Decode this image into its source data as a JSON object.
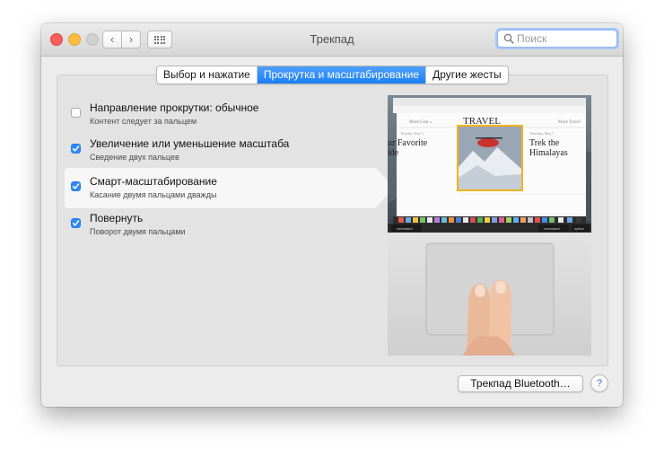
{
  "window": {
    "title": "Трекпад",
    "nav_back": "‹",
    "nav_forward": "›"
  },
  "search": {
    "placeholder": "Поиск"
  },
  "tabs": [
    {
      "label": "Выбор и нажатие",
      "active": false
    },
    {
      "label": "Прокрутка и масштабирование",
      "active": true
    },
    {
      "label": "Другие жесты",
      "active": false
    }
  ],
  "options": [
    {
      "title": "Направление прокрутки: обычное",
      "subtitle": "Контент следует за пальцем",
      "checked": false,
      "selected": false
    },
    {
      "title": "Увеличение или уменьшение масштаба",
      "subtitle": "Сведение двух пальцев",
      "checked": true,
      "selected": false
    },
    {
      "title": "Смарт-масштабирование",
      "subtitle": "Касание двумя пальцами дважды",
      "checked": true,
      "selected": true
    },
    {
      "title": "Повернуть",
      "subtitle": "Поворот двумя пальцами",
      "checked": true,
      "selected": false
    }
  ],
  "preview": {
    "nav_left": "More Gear »",
    "nav_right": "More Travel",
    "section": "TRAVEL",
    "article_left": "ur Favorite\nide",
    "date_left": "Tuesday, May 5",
    "date_right": "Thursday, May 7",
    "article_right": "Trek the\nHimalayas",
    "key_left": "command",
    "key_right": "command",
    "key_option": "option"
  },
  "buttons": {
    "bluetooth": "Трекпад Bluetooth…",
    "help": "?"
  },
  "colors": {
    "accent": "#2f88f6",
    "tab_active": "#1a7ef5",
    "close": "#fc605c",
    "minimize": "#fdbc40"
  }
}
